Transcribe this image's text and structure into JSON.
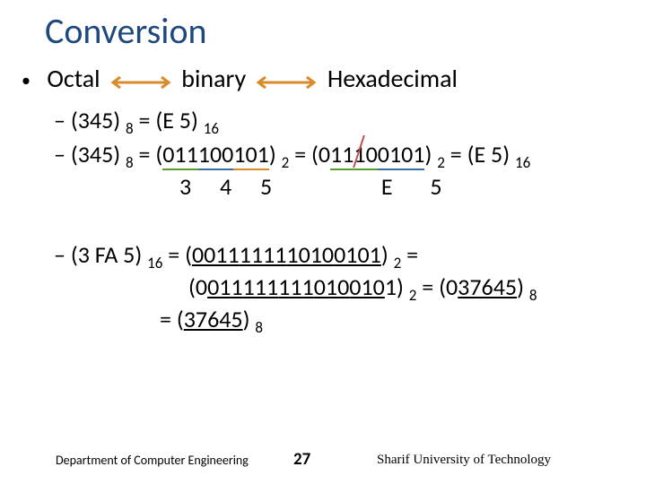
{
  "title": "Conversion",
  "bullet1": {
    "a": "Octal",
    "b": "binary",
    "c": "Hexadecimal"
  },
  "line2": {
    "pre": "– (345) ",
    "sub1": "8",
    "mid": " = (E 5) ",
    "sub2": "16"
  },
  "line3": {
    "pre": "– (345) ",
    "sub1": "8",
    "eq": " = (",
    "g1": "011",
    "g2": "100",
    "g3": "101",
    "close1": ") ",
    "sub2": "2",
    "eq2": " = (",
    "drop": "0",
    "h1": "1110",
    "h2": "0101",
    "close2": ") ",
    "sub3": "2",
    "eq3": " = (E 5) ",
    "sub4": "16"
  },
  "line3b": {
    "d3": "3",
    "d4": "4",
    "d5": "5",
    "E": "E",
    "F5": "5"
  },
  "line5": {
    "pre": "– (3 FA 5) ",
    "sub1": "16",
    "eq": " = (",
    "g1": "0011",
    "g2": "1111",
    "g3": "1010",
    "g4": "0101",
    "close": ") ",
    "sub2": "2",
    "eq2": " ="
  },
  "line6": {
    "open": "(",
    "g1": "0",
    "g2": "011",
    "g3": "111",
    "g4": "111",
    "g5": "010",
    "g6": "010",
    "g7": "1",
    "close": ") ",
    "sub1": "2",
    "eq": " = (0",
    "r": "37645",
    "close2": ") ",
    "sub2": "8"
  },
  "line7": {
    "eq": "=  (",
    "r": "37645",
    "close": ") ",
    "sub": "8"
  },
  "footer": {
    "left": "Department of Computer Engineering",
    "page": "27",
    "right": "Sharif University of Technology"
  }
}
